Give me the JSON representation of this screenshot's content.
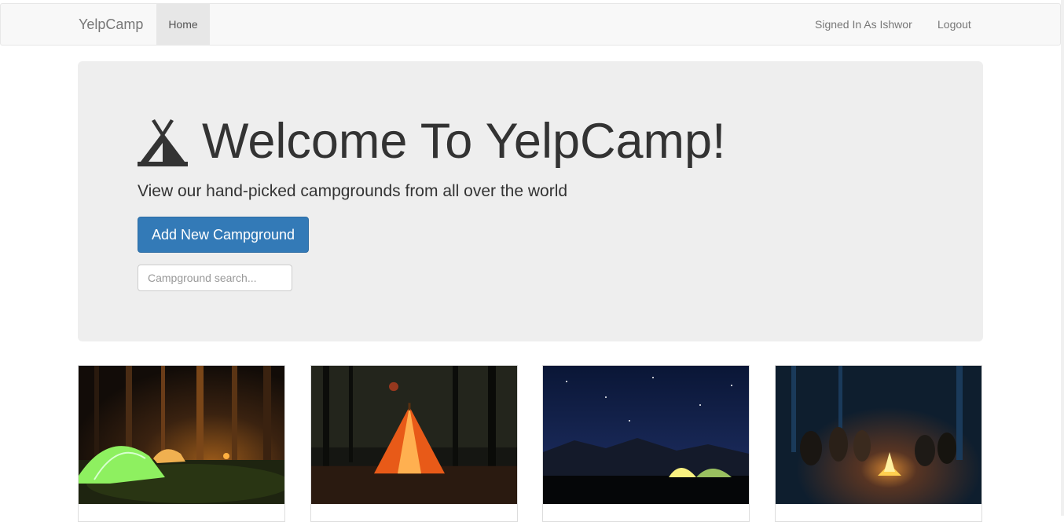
{
  "navbar": {
    "brand": "YelpCamp",
    "home_label": "Home",
    "signed_in_label": "Signed In As Ishwor",
    "logout_label": "Logout"
  },
  "hero": {
    "title": "Welcome To YelpCamp!",
    "subtitle": "View our hand-picked campgrounds from all over the world",
    "add_button_label": "Add New Campground",
    "search_placeholder": "Campground search...",
    "icon": "tent-icon"
  },
  "campgrounds": [
    {
      "image": "green-tent-forest-night-photo"
    },
    {
      "image": "orange-teepee-forest-photo"
    },
    {
      "image": "tents-under-starry-sky-photo"
    },
    {
      "image": "campfire-group-night-photo"
    }
  ],
  "colors": {
    "primary": "#337ab7",
    "navbar_bg": "#f8f8f8",
    "jumbotron_bg": "#eeeeee"
  }
}
